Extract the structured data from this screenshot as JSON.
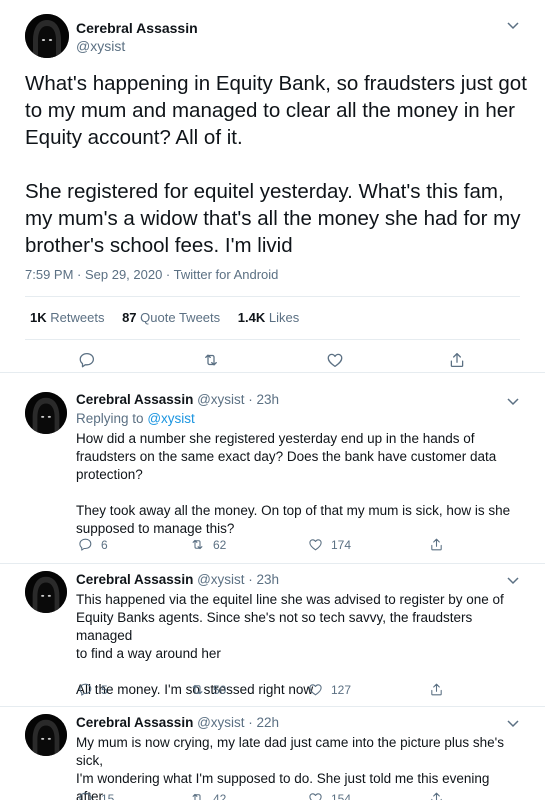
{
  "main_tweet": {
    "author_name": "Cerebral Assassin",
    "author_handle": "@xysist",
    "text": "What's happening in Equity Bank, so fraudsters just got\nto my mum and managed to clear all the money in her\nEquity account? All of it.\n\nShe registered for equitel yesterday. What's this fam,\nmy mum's a widow that's all the money she had for my\nbrother's school fees. I'm livid",
    "meta": "7:59 PM · Sep 29, 2020 · Twitter for Android",
    "retweets_count": "1K",
    "retweets_label": "Retweets",
    "quotes_count": "87",
    "quotes_label": "Quote Tweets",
    "likes_count": "1.4K",
    "likes_label": "Likes"
  },
  "replies": [
    {
      "author_name": "Cerebral Assassin",
      "meta": "@xysist · 23h",
      "replying_prefix": "Replying to",
      "replying_to": "@xysist",
      "text": "How did a number she registered yesterday end up in the hands of\nfraudsters on the same exact day? Does the bank have customer data\nprotection?\n\nThey took away all the money. On top of that my mum is sick, how is she\nsupposed to manage this?",
      "reply_count": "6",
      "retweet_count": "62",
      "like_count": "174"
    },
    {
      "author_name": "Cerebral Assassin",
      "meta": "@xysist · 23h",
      "text": "This happened via the equitel line she was advised to register by one of\nEquity Banks agents. Since she's not so tech savvy, the fraudsters managed\nto find a way around her\n\nAll the money. I'm so stressed right now",
      "reply_count": "5",
      "retweet_count": "50",
      "like_count": "127"
    },
    {
      "author_name": "Cerebral Assassin",
      "meta": "@xysist · 22h",
      "text": "My mum is now crying, my late dad just came into the picture plus she's sick,\nI'm wondering what I'm supposed to do. She just told me this evening after\nwork. Idk man idk",
      "reply_count": "15",
      "retweet_count": "42",
      "like_count": "154"
    }
  ],
  "colors": {
    "text": "#0f1419",
    "secondary": "#5b7083",
    "link": "#1b95e0",
    "divider": "#e6ecf0"
  },
  "icons": [
    "hooded-avatar",
    "chevron-down-icon",
    "reply-icon",
    "retweet-icon",
    "like-icon",
    "share-icon"
  ]
}
